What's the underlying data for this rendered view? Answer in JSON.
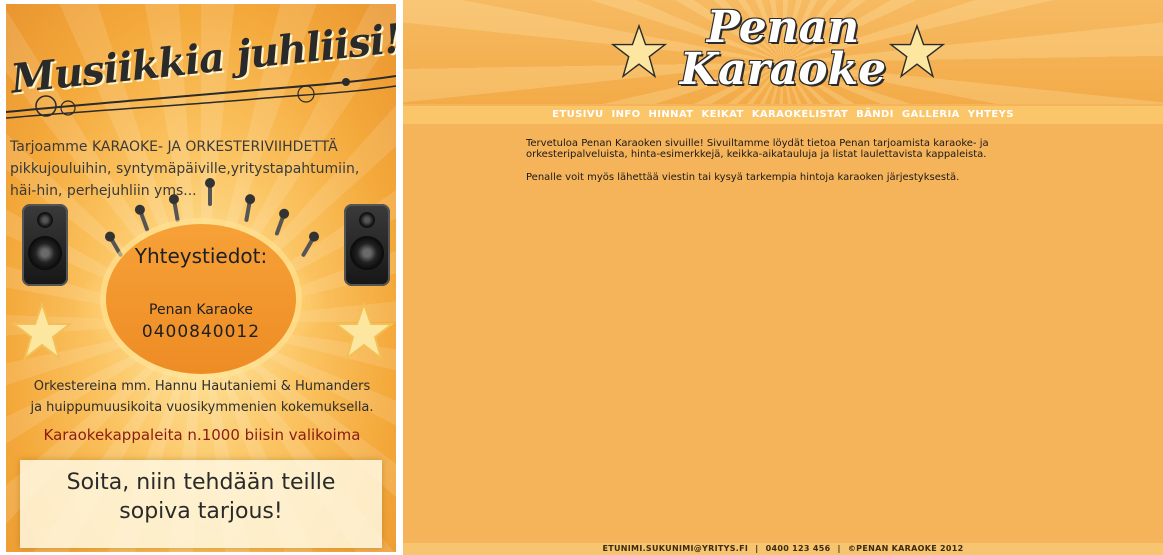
{
  "poster": {
    "title": "Musiikkia juhliisi!",
    "intro": "Tarjoamme KARAOKE- JA ORKESTERIVIIHDETTÄ pikkujouluihin, syntymäpäiville,yritystapahtumiin, häi-hin, perhejuhliin yms...",
    "contact_heading": "Yhteystiedot:",
    "contact_name": "Penan Karaoke",
    "contact_phone": "0400840012",
    "band_line_1": "Orkestereina mm. Hannu Hautaniemi & Humanders",
    "band_line_2": "ja huippumuusikoita vuosikymmenien kokemuksella.",
    "highlight": "Karaokekappaleita n.1000 biisin valikoima",
    "offer_line_1": "Soita, niin tehdään teille",
    "offer_line_2": "sopiva tarjous!"
  },
  "header": {
    "logo_line_1": "Penan",
    "logo_line_2": "Karaoke"
  },
  "nav": {
    "items": [
      {
        "label": "ETUSIVU"
      },
      {
        "label": "INFO"
      },
      {
        "label": "HINNAT"
      },
      {
        "label": "KEIKAT"
      },
      {
        "label": "KARAOKELISTAT"
      },
      {
        "label": "BÄNDI"
      },
      {
        "label": "GALLERIA"
      },
      {
        "label": "YHTEYS"
      }
    ]
  },
  "content": {
    "paragraph_1": "Tervetuloa Penan Karaoken sivuille! Sivuiltamme löydät tietoa Penan tarjoamista karaoke- ja orkesteripalveluista, hinta-esimerkkejä, keikka-aikatauluja ja listat laulettavista kappaleista.",
    "paragraph_2": "Penalle voit myös lähettää viestin tai kysyä tarkempia hintoja karaoken järjestyksestä."
  },
  "footer": {
    "email": "ETUNIMI.SUKUNIMI@YRITYS.FI",
    "phone": "0400 123 456",
    "copyright": "©PENAN KARAOKE 2012",
    "separator": "|"
  },
  "colors": {
    "site_background": "#f5b35a",
    "nav_background": "#fbc66a",
    "nav_text": "#ffffff",
    "poster_highlight": "#8a1d12"
  }
}
